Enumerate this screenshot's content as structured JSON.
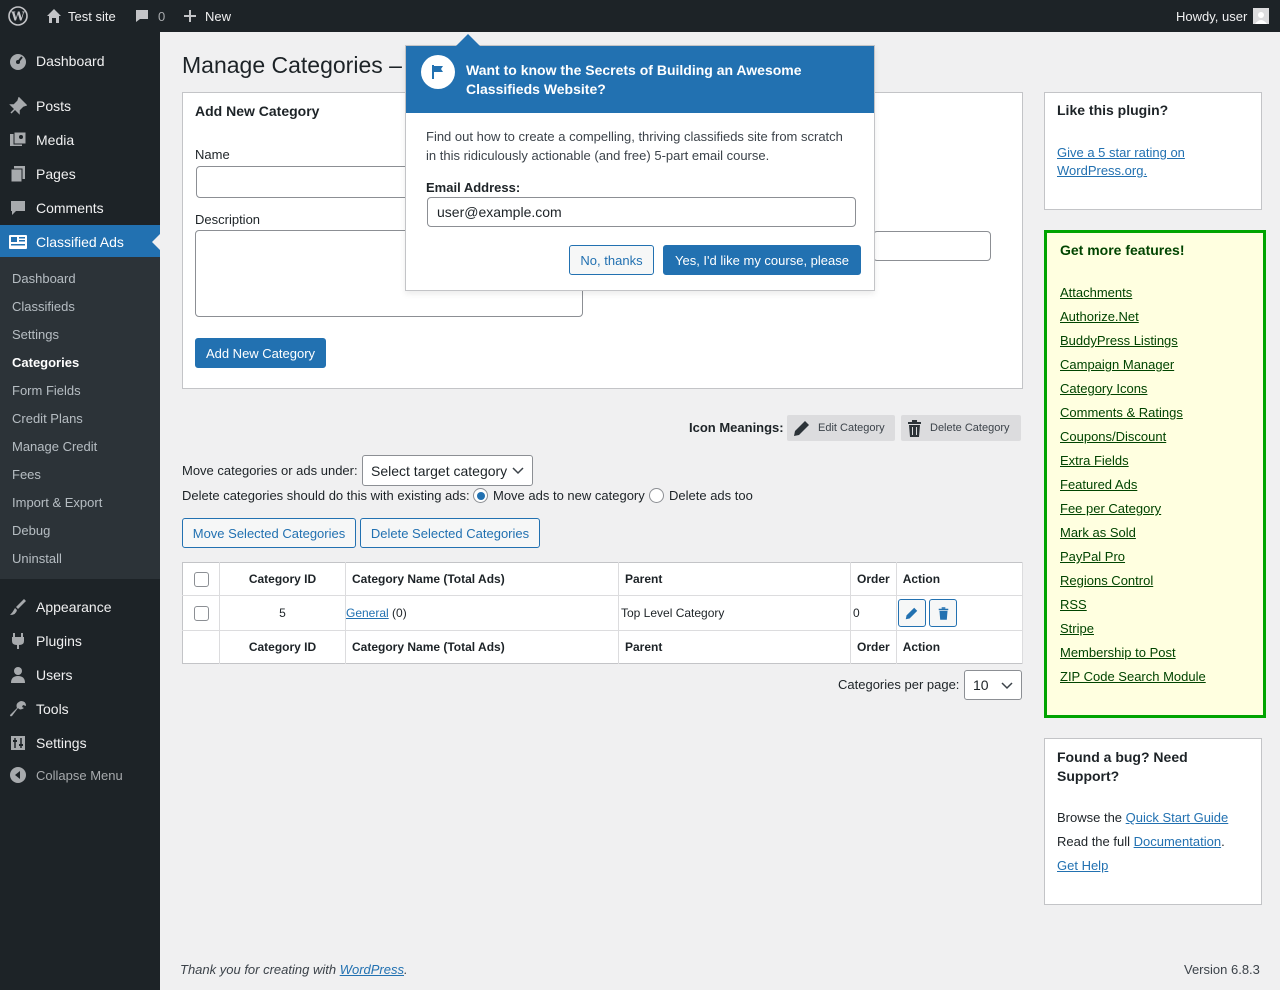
{
  "admin_bar": {
    "site_name": "Test site",
    "comments_count": "0",
    "new_label": "New",
    "howdy": "Howdy, user"
  },
  "sidebar": {
    "top_items": [
      {
        "label": "Dashboard",
        "icon": "dashboard-icon"
      },
      {
        "label": "Posts",
        "icon": "pin-icon"
      },
      {
        "label": "Media",
        "icon": "media-icon"
      },
      {
        "label": "Pages",
        "icon": "pages-icon"
      },
      {
        "label": "Comments",
        "icon": "comment-icon"
      },
      {
        "label": "Classified Ads",
        "icon": "classified-icon"
      }
    ],
    "submenu": [
      "Dashboard",
      "Classifieds",
      "Settings",
      "Categories",
      "Form Fields",
      "Credit Plans",
      "Manage Credit",
      "Fees",
      "Import & Export",
      "Debug",
      "Uninstall"
    ],
    "bottom_items": [
      {
        "label": "Appearance",
        "icon": "brush-icon"
      },
      {
        "label": "Plugins",
        "icon": "plugin-icon"
      },
      {
        "label": "Users",
        "icon": "users-icon"
      },
      {
        "label": "Tools",
        "icon": "wrench-icon"
      },
      {
        "label": "Settings",
        "icon": "settings-icon"
      },
      {
        "label": "Collapse Menu",
        "icon": "collapse-icon"
      }
    ]
  },
  "page_title": "Manage Categories –",
  "add_category": {
    "heading": "Add New Category",
    "name_label": "Name",
    "name_value": "",
    "description_label": "Description",
    "description_value": "",
    "button": "Add New Category"
  },
  "icon_meanings": {
    "label": "Icon Meanings:",
    "edit": "Edit Category",
    "delete": "Delete Category"
  },
  "move": {
    "label": "Move categories or ads under:",
    "select_value": "Select target category",
    "delete_label": "Delete categories should do this with existing ads:",
    "option_move": "Move ads to new category",
    "option_delete": "Delete ads too",
    "move_button": "Move Selected Categories",
    "delete_button": "Delete Selected Categories"
  },
  "table": {
    "headers": [
      "Category ID",
      "Category Name (Total Ads)",
      "Parent",
      "Order",
      "Action"
    ],
    "rows": [
      {
        "id": "5",
        "name": "General",
        "count": "(0)",
        "parent": "Top Level Category",
        "order": "0"
      }
    ]
  },
  "per_page": {
    "label": "Categories per page:",
    "value": "10"
  },
  "pointer": {
    "title": "Want to know the Secrets of Building an Awesome Classifieds Website?",
    "body": "Find out how to create a compelling, thriving classifieds site from scratch in this ridiculously actionable (and free) 5-part email course.",
    "email_label": "Email Address:",
    "email_value": "user@example.com",
    "no_button": "No, thanks",
    "yes_button": "Yes, I'd like my course, please"
  },
  "like_box": {
    "heading": "Like this plugin?",
    "link": "Give a 5 star rating on WordPress.org."
  },
  "features": {
    "heading": "Get more features!",
    "links": [
      "Attachments",
      "Authorize.Net",
      "BuddyPress Listings",
      "Campaign Manager",
      "Category Icons",
      "Comments & Ratings",
      "Coupons/Discount",
      "Extra Fields",
      "Featured Ads",
      "Fee per Category",
      "Mark as Sold",
      "PayPal Pro",
      "Regions Control",
      "RSS",
      "Stripe",
      "Membership to Post",
      "ZIP Code Search Module"
    ]
  },
  "support": {
    "heading": "Found a bug? Need Support?",
    "browse_prefix": "Browse the",
    "quick_start": "Quick Start Guide",
    "read_prefix": "Read the full",
    "documentation": "Documentation",
    "period": ".",
    "get_help": "Get Help"
  },
  "footer": {
    "thanks_prefix": "Thank you for creating with",
    "wordpress": "WordPress",
    "period": ".",
    "version": "Version 6.8.3"
  },
  "colors": {
    "admin_dark": "#1d2327",
    "primary": "#2271b1",
    "features_border": "#00a400",
    "features_bg": "#ffffe0"
  }
}
